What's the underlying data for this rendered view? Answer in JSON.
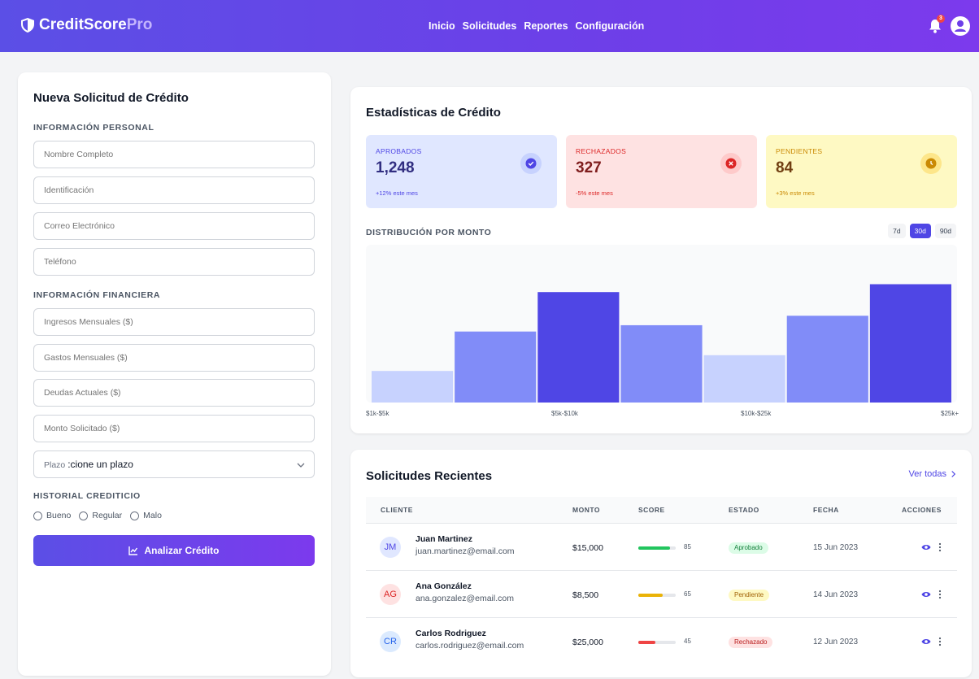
{
  "header": {
    "brand_main": "CreditScore",
    "brand_accent": "Pro",
    "nav": [
      "Inicio",
      "Solicitudes",
      "Reportes",
      "Configuración"
    ],
    "notification_count": "3"
  },
  "form": {
    "title": "Nueva Solicitud de Crédito",
    "personal_label": "INFORMACIÓN PERSONAL",
    "personal_fields": [
      "Nombre Completo",
      "Identificación",
      "Correo Electrónico",
      "Teléfono"
    ],
    "financial_label": "INFORMACIÓN FINANCIERA",
    "financial_fields": [
      "Ingresos Mensuales ($)",
      "Gastos Mensuales ($)",
      "Deudas Actuales ($)",
      "Monto Solicitado ($)"
    ],
    "term_label": "Plazo",
    "term_value": ":cione un plazo",
    "history_label": "HISTORIAL CREDITICIO",
    "history_options": [
      "Bueno",
      "Regular",
      "Malo"
    ],
    "submit_label": "Analizar Crédito"
  },
  "stats": {
    "title": "Estadísticas de Crédito",
    "cards": [
      {
        "label": "APROBADOS",
        "value": "1,248",
        "change": "+12% este mes",
        "bg": "#e0e7ff",
        "fg": "#4f46e5",
        "valueColor": "#312e81",
        "icon": "check-circle-icon"
      },
      {
        "label": "RECHAZADOS",
        "value": "327",
        "change": "-5% este mes",
        "bg": "#fee2e2",
        "fg": "#dc2626",
        "valueColor": "#7f1d1d",
        "icon": "x-circle-icon"
      },
      {
        "label": "PENDIENTES",
        "value": "84",
        "change": "+3% este mes",
        "bg": "#fef9c3",
        "fg": "#ca8a04",
        "valueColor": "#713f12",
        "icon": "clock-icon"
      }
    ],
    "distribution_label": "DISTRIBUCIÓN POR MONTO",
    "ranges": [
      "7d",
      "30d",
      "90d"
    ],
    "active_range": "30d"
  },
  "chart_data": {
    "type": "bar",
    "categories": [
      "$1k-$5k",
      "",
      "$5k-$10k",
      "",
      "$10k-$25k",
      "",
      "$25k+"
    ],
    "values": [
      20,
      45,
      70,
      49,
      30,
      55,
      75
    ],
    "colors": [
      "#c7d2fe",
      "#818cf8",
      "#4f46e5",
      "#818cf8",
      "#c7d2fe",
      "#818cf8",
      "#4f46e5"
    ],
    "x_tick_labels": [
      "$1k-$5k",
      "$5k-$10k",
      "$10k-$25k",
      "$25k+"
    ],
    "ylim": [
      0,
      100
    ]
  },
  "recent": {
    "title": "Solicitudes Recientes",
    "view_all": "Ver todas",
    "columns": [
      "CLIENTE",
      "MONTO",
      "SCORE",
      "ESTADO",
      "FECHA",
      "ACCIONES"
    ],
    "rows": [
      {
        "initials": "JM",
        "name": "Juan Martinez",
        "email": "juan.martinez@email.com",
        "amount": "$15,000",
        "score": "85",
        "score_pct": 0.85,
        "bar": "#22c55e",
        "status": "Aprobado",
        "status_bg": "#dcfce7",
        "status_fg": "#15803d",
        "date": "15 Jun 2023",
        "avatar_bg": "#e0e7ff",
        "avatar_fg": "#4f46e5"
      },
      {
        "initials": "AG",
        "name": "Ana González",
        "email": "ana.gonzalez@email.com",
        "amount": "$8,500",
        "score": "65",
        "score_pct": 0.65,
        "bar": "#eab308",
        "status": "Pendiente",
        "status_bg": "#fef9c3",
        "status_fg": "#a16207",
        "date": "14 Jun 2023",
        "avatar_bg": "#fee2e2",
        "avatar_fg": "#dc2626"
      },
      {
        "initials": "CR",
        "name": "Carlos Rodriguez",
        "email": "carlos.rodriguez@email.com",
        "amount": "$25,000",
        "score": "45",
        "score_pct": 0.45,
        "bar": "#ef4444",
        "status": "Rechazado",
        "status_bg": "#fee2e2",
        "status_fg": "#b91c1c",
        "date": "12 Jun 2023",
        "avatar_bg": "#dbeafe",
        "avatar_fg": "#2563eb"
      }
    ]
  }
}
